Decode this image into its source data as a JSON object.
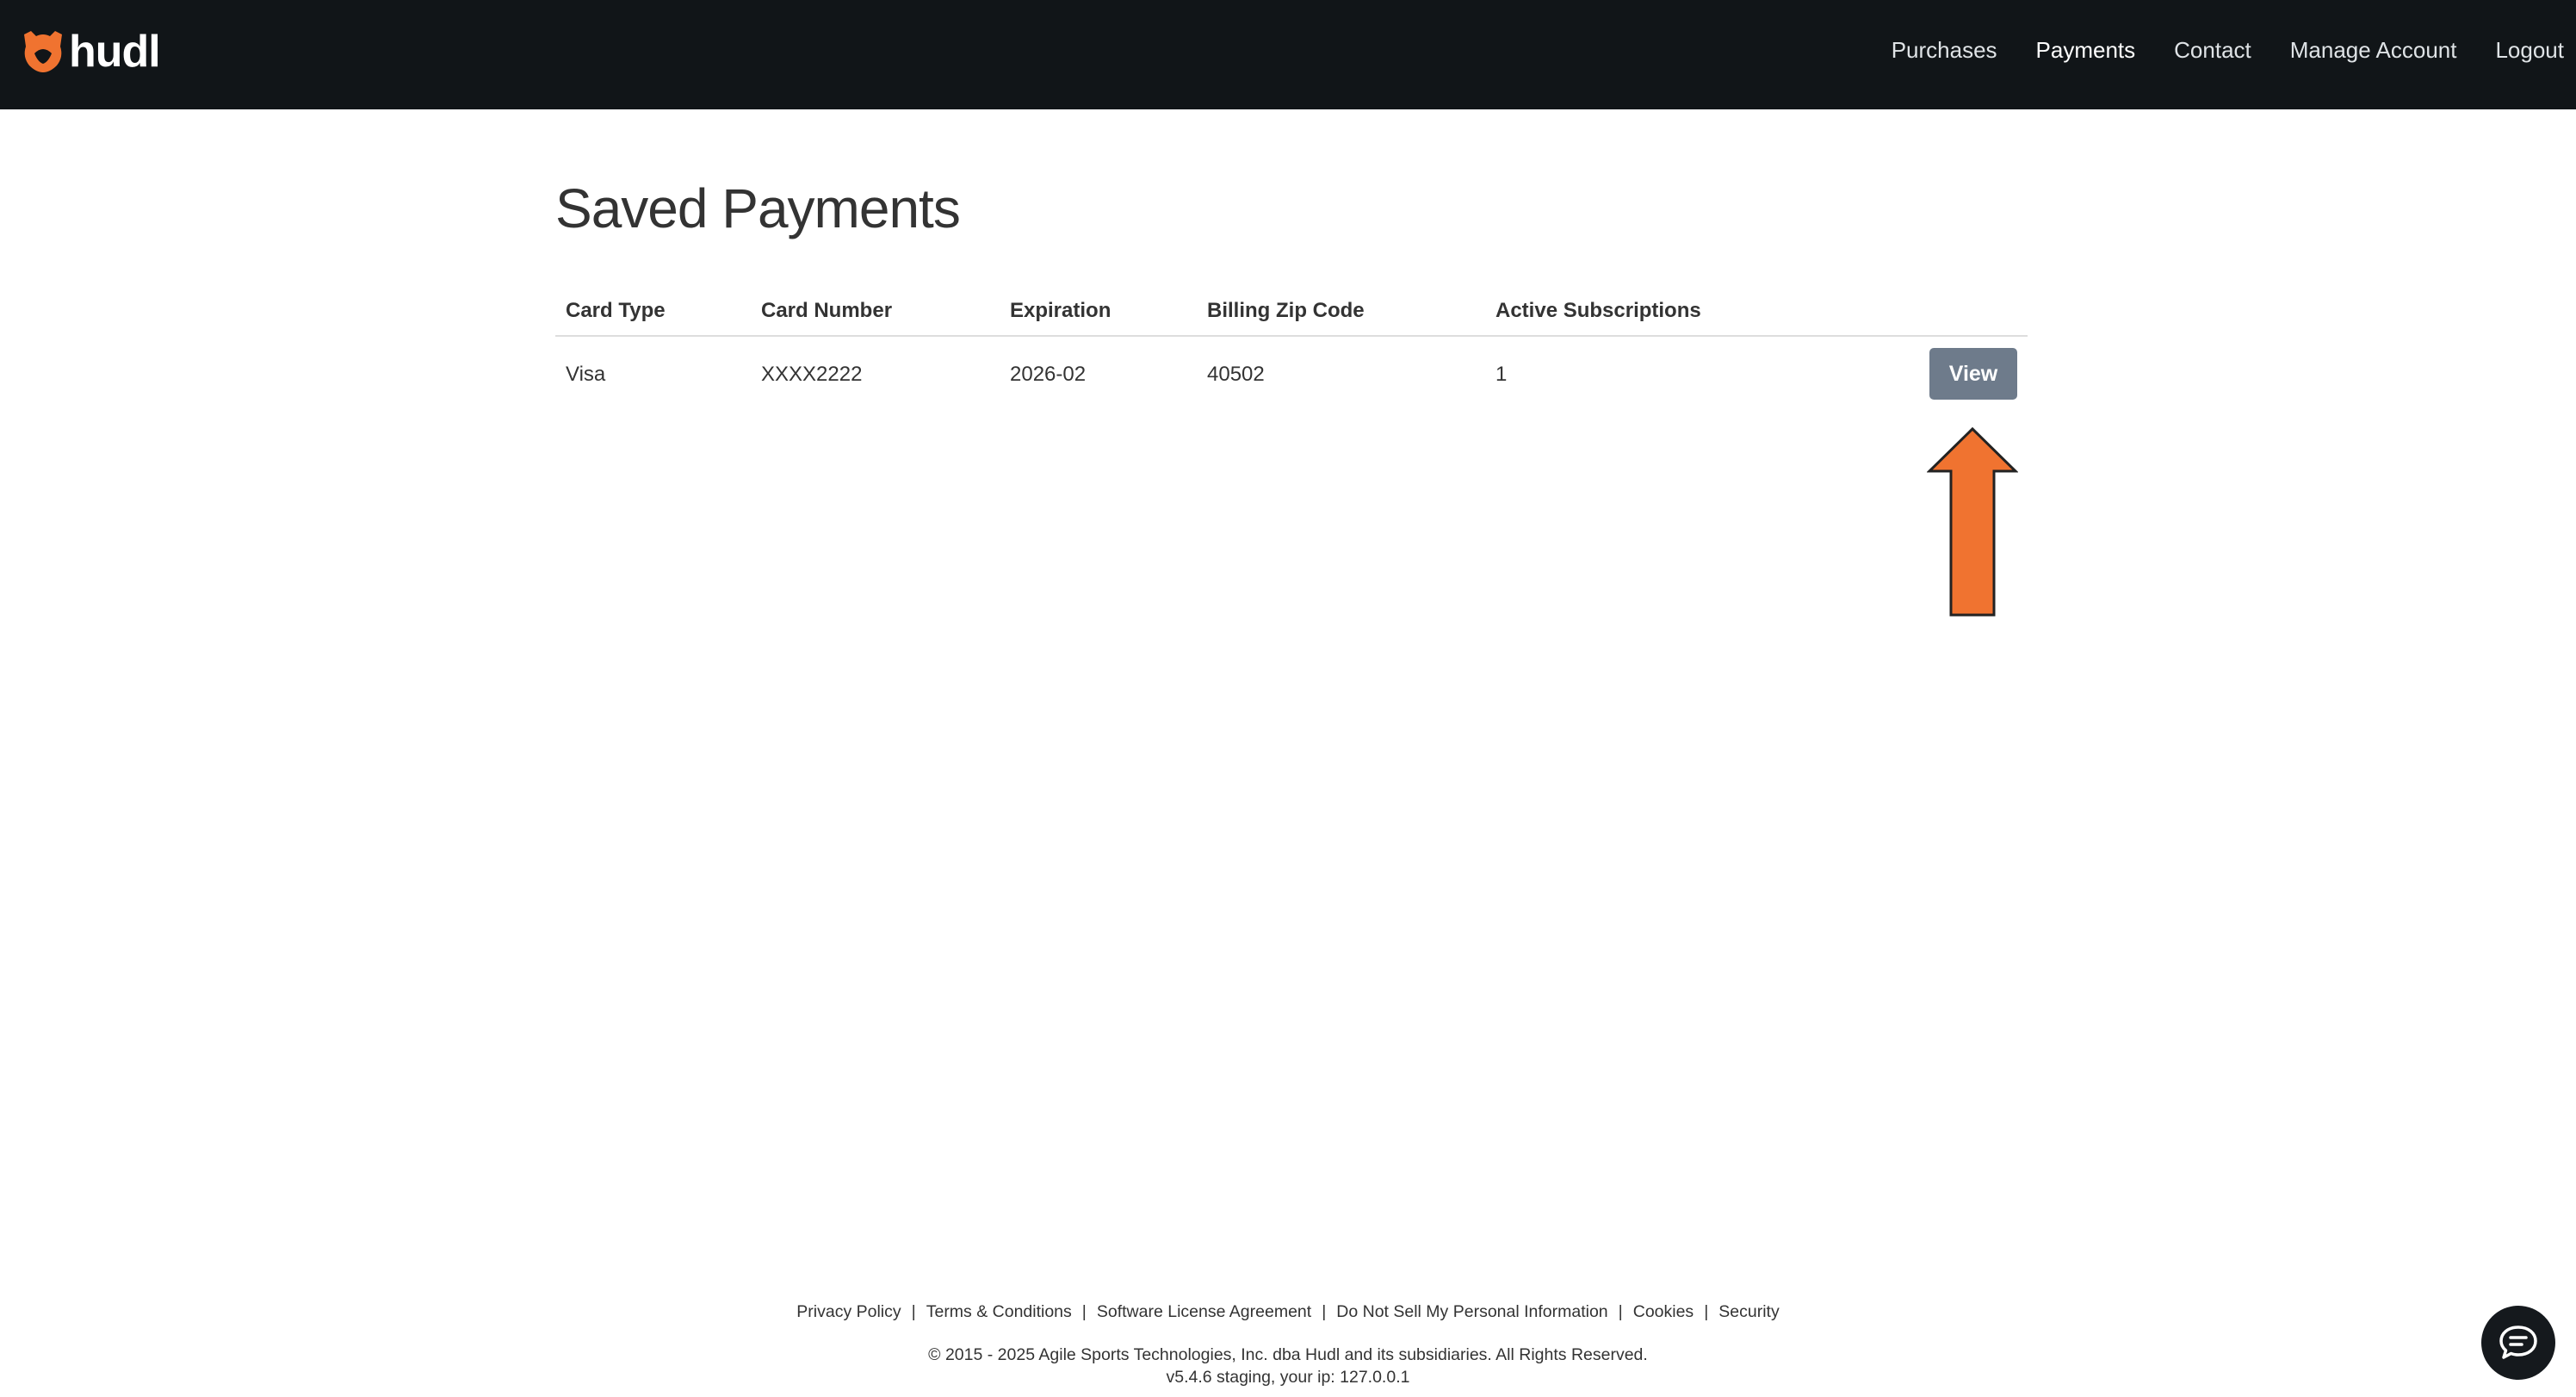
{
  "header": {
    "brand": "hudl",
    "nav": [
      {
        "label": "Purchases",
        "active": false
      },
      {
        "label": "Payments",
        "active": true
      },
      {
        "label": "Contact",
        "active": false
      },
      {
        "label": "Manage Account",
        "active": false
      },
      {
        "label": "Logout",
        "active": false
      }
    ]
  },
  "main": {
    "title": "Saved Payments",
    "columns": [
      "Card Type",
      "Card Number",
      "Expiration",
      "Billing Zip Code",
      "Active Subscriptions"
    ],
    "rows": [
      {
        "card_type": "Visa",
        "card_number": "XXXX2222",
        "expiration": "2026-02",
        "billing_zip": "40502",
        "active_subscriptions": "1",
        "action_label": "View"
      }
    ]
  },
  "annotation": {
    "icon": "arrow-up-icon",
    "color": "#f07330"
  },
  "footer": {
    "links": [
      "Privacy Policy",
      "Terms & Conditions",
      "Software License Agreement",
      "Do Not Sell My Personal Information",
      "Cookies",
      "Security"
    ],
    "separator": "|",
    "copyright": "© 2015 - 2025 Agile Sports Technologies, Inc. dba Hudl and its subsidiaries. All Rights Reserved.",
    "version": "v5.4.6 staging, your ip: 127.0.0.1"
  },
  "chat": {
    "icon": "chat-bubble-icon"
  },
  "colors": {
    "topbar": "#111518",
    "brand_orange": "#f07330",
    "button": "#6e7b8b"
  }
}
